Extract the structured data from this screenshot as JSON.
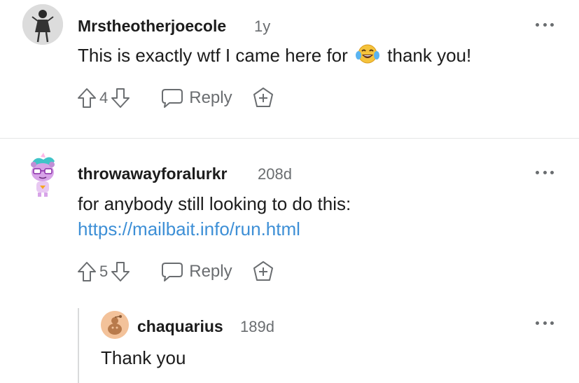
{
  "comments": [
    {
      "username": "Mrstheotherjoecole",
      "age": "1y",
      "text_before_emoji": "This is exactly wtf I came here for",
      "emoji": "face-with-tears-of-joy",
      "text_after_emoji": "thank you!",
      "score": "4",
      "reply_label": "Reply"
    },
    {
      "username": "throwawayforalurkr",
      "age": "208d",
      "text_line1": "for anybody still looking to do this:",
      "link": "https://mailbait.info/run.html",
      "score": "5",
      "reply_label": "Reply"
    },
    {
      "username": "chaquarius",
      "age": "189d",
      "text": "Thank you"
    }
  ],
  "colors": {
    "link": "#3d8fd6",
    "meta": "#6a6d70",
    "text": "#1c1c1c",
    "divider": "#e4e5e6"
  },
  "icons": [
    "upvote-icon",
    "downvote-icon",
    "reply-bubble-icon",
    "award-icon",
    "more-options-icon",
    "laughing-emoji-icon"
  ]
}
